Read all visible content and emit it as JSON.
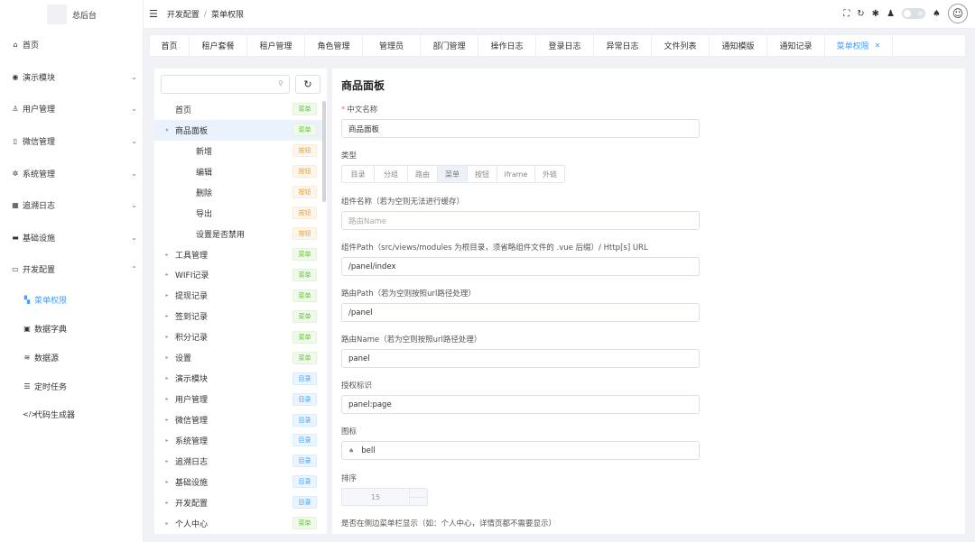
{
  "app": {
    "title": "总后台"
  },
  "sidebar": {
    "items": [
      {
        "label": "首页",
        "icon": "home-icon",
        "glyph": "⌂",
        "chevron": ""
      },
      {
        "label": "演示模块",
        "icon": "demo-icon",
        "glyph": "◉",
        "chevron": "⌄"
      },
      {
        "label": "用户管理",
        "icon": "user-icon",
        "glyph": "♙",
        "chevron": "⌄"
      },
      {
        "label": "微信管理",
        "icon": "mobile-icon",
        "glyph": "▯",
        "chevron": "⌄"
      },
      {
        "label": "系统管理",
        "icon": "gear-icon",
        "glyph": "✲",
        "chevron": "⌄"
      },
      {
        "label": "追溯日志",
        "icon": "log-icon",
        "glyph": "▦",
        "chevron": "⌄"
      },
      {
        "label": "基础设施",
        "icon": "folder-icon",
        "glyph": "▬",
        "chevron": "⌄"
      },
      {
        "label": "开发配置",
        "icon": "dev-icon",
        "glyph": "▭",
        "chevron": "⌃"
      }
    ],
    "sub_items": [
      {
        "label": "菜单权限",
        "icon": "grid-icon",
        "glyph": "▚",
        "active": true
      },
      {
        "label": "数据字典",
        "icon": "dictionary-icon",
        "glyph": "▣",
        "active": false
      },
      {
        "label": "数据源",
        "icon": "database-icon",
        "glyph": "≋",
        "active": false
      },
      {
        "label": "定时任务",
        "icon": "list-icon",
        "glyph": "☰",
        "active": false
      },
      {
        "label": "代码生成器",
        "icon": "code-icon",
        "glyph": "</>",
        "active": false
      }
    ]
  },
  "header": {
    "breadcrumb": [
      "开发配置",
      "菜单权限"
    ],
    "breadcrumb_sep": "/",
    "toggle_label": "暗",
    "avatar_glyph": "☺"
  },
  "tabs": [
    {
      "label": "首页",
      "active": false
    },
    {
      "label": "租户套餐",
      "active": false
    },
    {
      "label": "租户管理",
      "active": false
    },
    {
      "label": "角色管理",
      "active": false
    },
    {
      "label": "管理员",
      "active": false
    },
    {
      "label": "部门管理",
      "active": false
    },
    {
      "label": "操作日志",
      "active": false
    },
    {
      "label": "登录日志",
      "active": false
    },
    {
      "label": "异常日志",
      "active": false
    },
    {
      "label": "文件列表",
      "active": false
    },
    {
      "label": "通知模版",
      "active": false
    },
    {
      "label": "通知记录",
      "active": false
    },
    {
      "label": "菜单权限",
      "active": true
    }
  ],
  "tree": {
    "search_placeholder": "",
    "nodes": [
      {
        "label": "首页",
        "badge": "菜单",
        "type": "menu",
        "level": 0,
        "arrow": ""
      },
      {
        "label": "商品面板",
        "badge": "菜单",
        "type": "menu",
        "level": 0,
        "arrow": "▾",
        "selected": true
      },
      {
        "label": "新增",
        "badge": "按钮",
        "type": "btn",
        "level": 1,
        "arrow": ""
      },
      {
        "label": "编辑",
        "badge": "按钮",
        "type": "btn",
        "level": 1,
        "arrow": ""
      },
      {
        "label": "删除",
        "badge": "按钮",
        "type": "btn",
        "level": 1,
        "arrow": ""
      },
      {
        "label": "导出",
        "badge": "按钮",
        "type": "btn",
        "level": 1,
        "arrow": ""
      },
      {
        "label": "设置是否禁用",
        "badge": "按钮",
        "type": "btn",
        "level": 1,
        "arrow": ""
      },
      {
        "label": "工具管理",
        "badge": "菜单",
        "type": "menu",
        "level": 0,
        "arrow": "▸"
      },
      {
        "label": "WIFI记录",
        "badge": "菜单",
        "type": "menu",
        "level": 0,
        "arrow": "▸"
      },
      {
        "label": "提现记录",
        "badge": "菜单",
        "type": "menu",
        "level": 0,
        "arrow": "▸"
      },
      {
        "label": "签到记录",
        "badge": "菜单",
        "type": "menu",
        "level": 0,
        "arrow": "▸"
      },
      {
        "label": "积分记录",
        "badge": "菜单",
        "type": "menu",
        "level": 0,
        "arrow": "▸"
      },
      {
        "label": "设置",
        "badge": "菜单",
        "type": "menu",
        "level": 0,
        "arrow": "▸"
      },
      {
        "label": "演示模块",
        "badge": "目录",
        "type": "dir",
        "level": 0,
        "arrow": "▸"
      },
      {
        "label": "用户管理",
        "badge": "目录",
        "type": "dir",
        "level": 0,
        "arrow": "▸"
      },
      {
        "label": "微信管理",
        "badge": "目录",
        "type": "dir",
        "level": 0,
        "arrow": "▸"
      },
      {
        "label": "系统管理",
        "badge": "目录",
        "type": "dir",
        "level": 0,
        "arrow": "▸"
      },
      {
        "label": "追溯日志",
        "badge": "目录",
        "type": "dir",
        "level": 0,
        "arrow": "▸"
      },
      {
        "label": "基础设施",
        "badge": "目录",
        "type": "dir",
        "level": 0,
        "arrow": "▸"
      },
      {
        "label": "开发配置",
        "badge": "目录",
        "type": "dir",
        "level": 0,
        "arrow": "▸"
      },
      {
        "label": "个人中心",
        "badge": "菜单",
        "type": "menu",
        "level": 0,
        "arrow": "▸"
      }
    ]
  },
  "form": {
    "title": "商品面板",
    "name_required_mark": "*",
    "name_label": "中文名称",
    "name_value": "商品面板",
    "type_label": "类型",
    "type_options": [
      {
        "label": "目录",
        "active": false
      },
      {
        "label": "分组",
        "active": false
      },
      {
        "label": "路由",
        "active": false
      },
      {
        "label": "菜单",
        "active": true
      },
      {
        "label": "按钮",
        "active": false
      },
      {
        "label": "iframe",
        "active": false
      },
      {
        "label": "外链",
        "active": false
      }
    ],
    "component_name_label": "组件名称（若为空则无法进行缓存）",
    "component_name_placeholder": "路由Name",
    "component_path_label": "组件Path（src/views/modules 为根目录，须省略组件文件的 .vue 后缀）/ Http[s] URL",
    "component_path_value": "/panel/index",
    "route_path_label": "路由Path（若为空则按照url路径处理）",
    "route_path_value": "/panel",
    "route_name_label": "路由Name（若为空则按照url路径处理）",
    "route_name_value": "panel",
    "auth_label": "授权标识",
    "auth_value": "panel:page",
    "icon_label": "图标",
    "icon_value": "bell",
    "sort_label": "排序",
    "sort_value": "15",
    "sidebar_show_label": "是否在侧边菜单栏显示（如：个人中心，详情页都不需要显示）"
  },
  "colors": {
    "accent": "#409eff",
    "badge_menu": "#67c23a",
    "badge_button": "#e6a23c",
    "badge_dir": "#409eff"
  }
}
